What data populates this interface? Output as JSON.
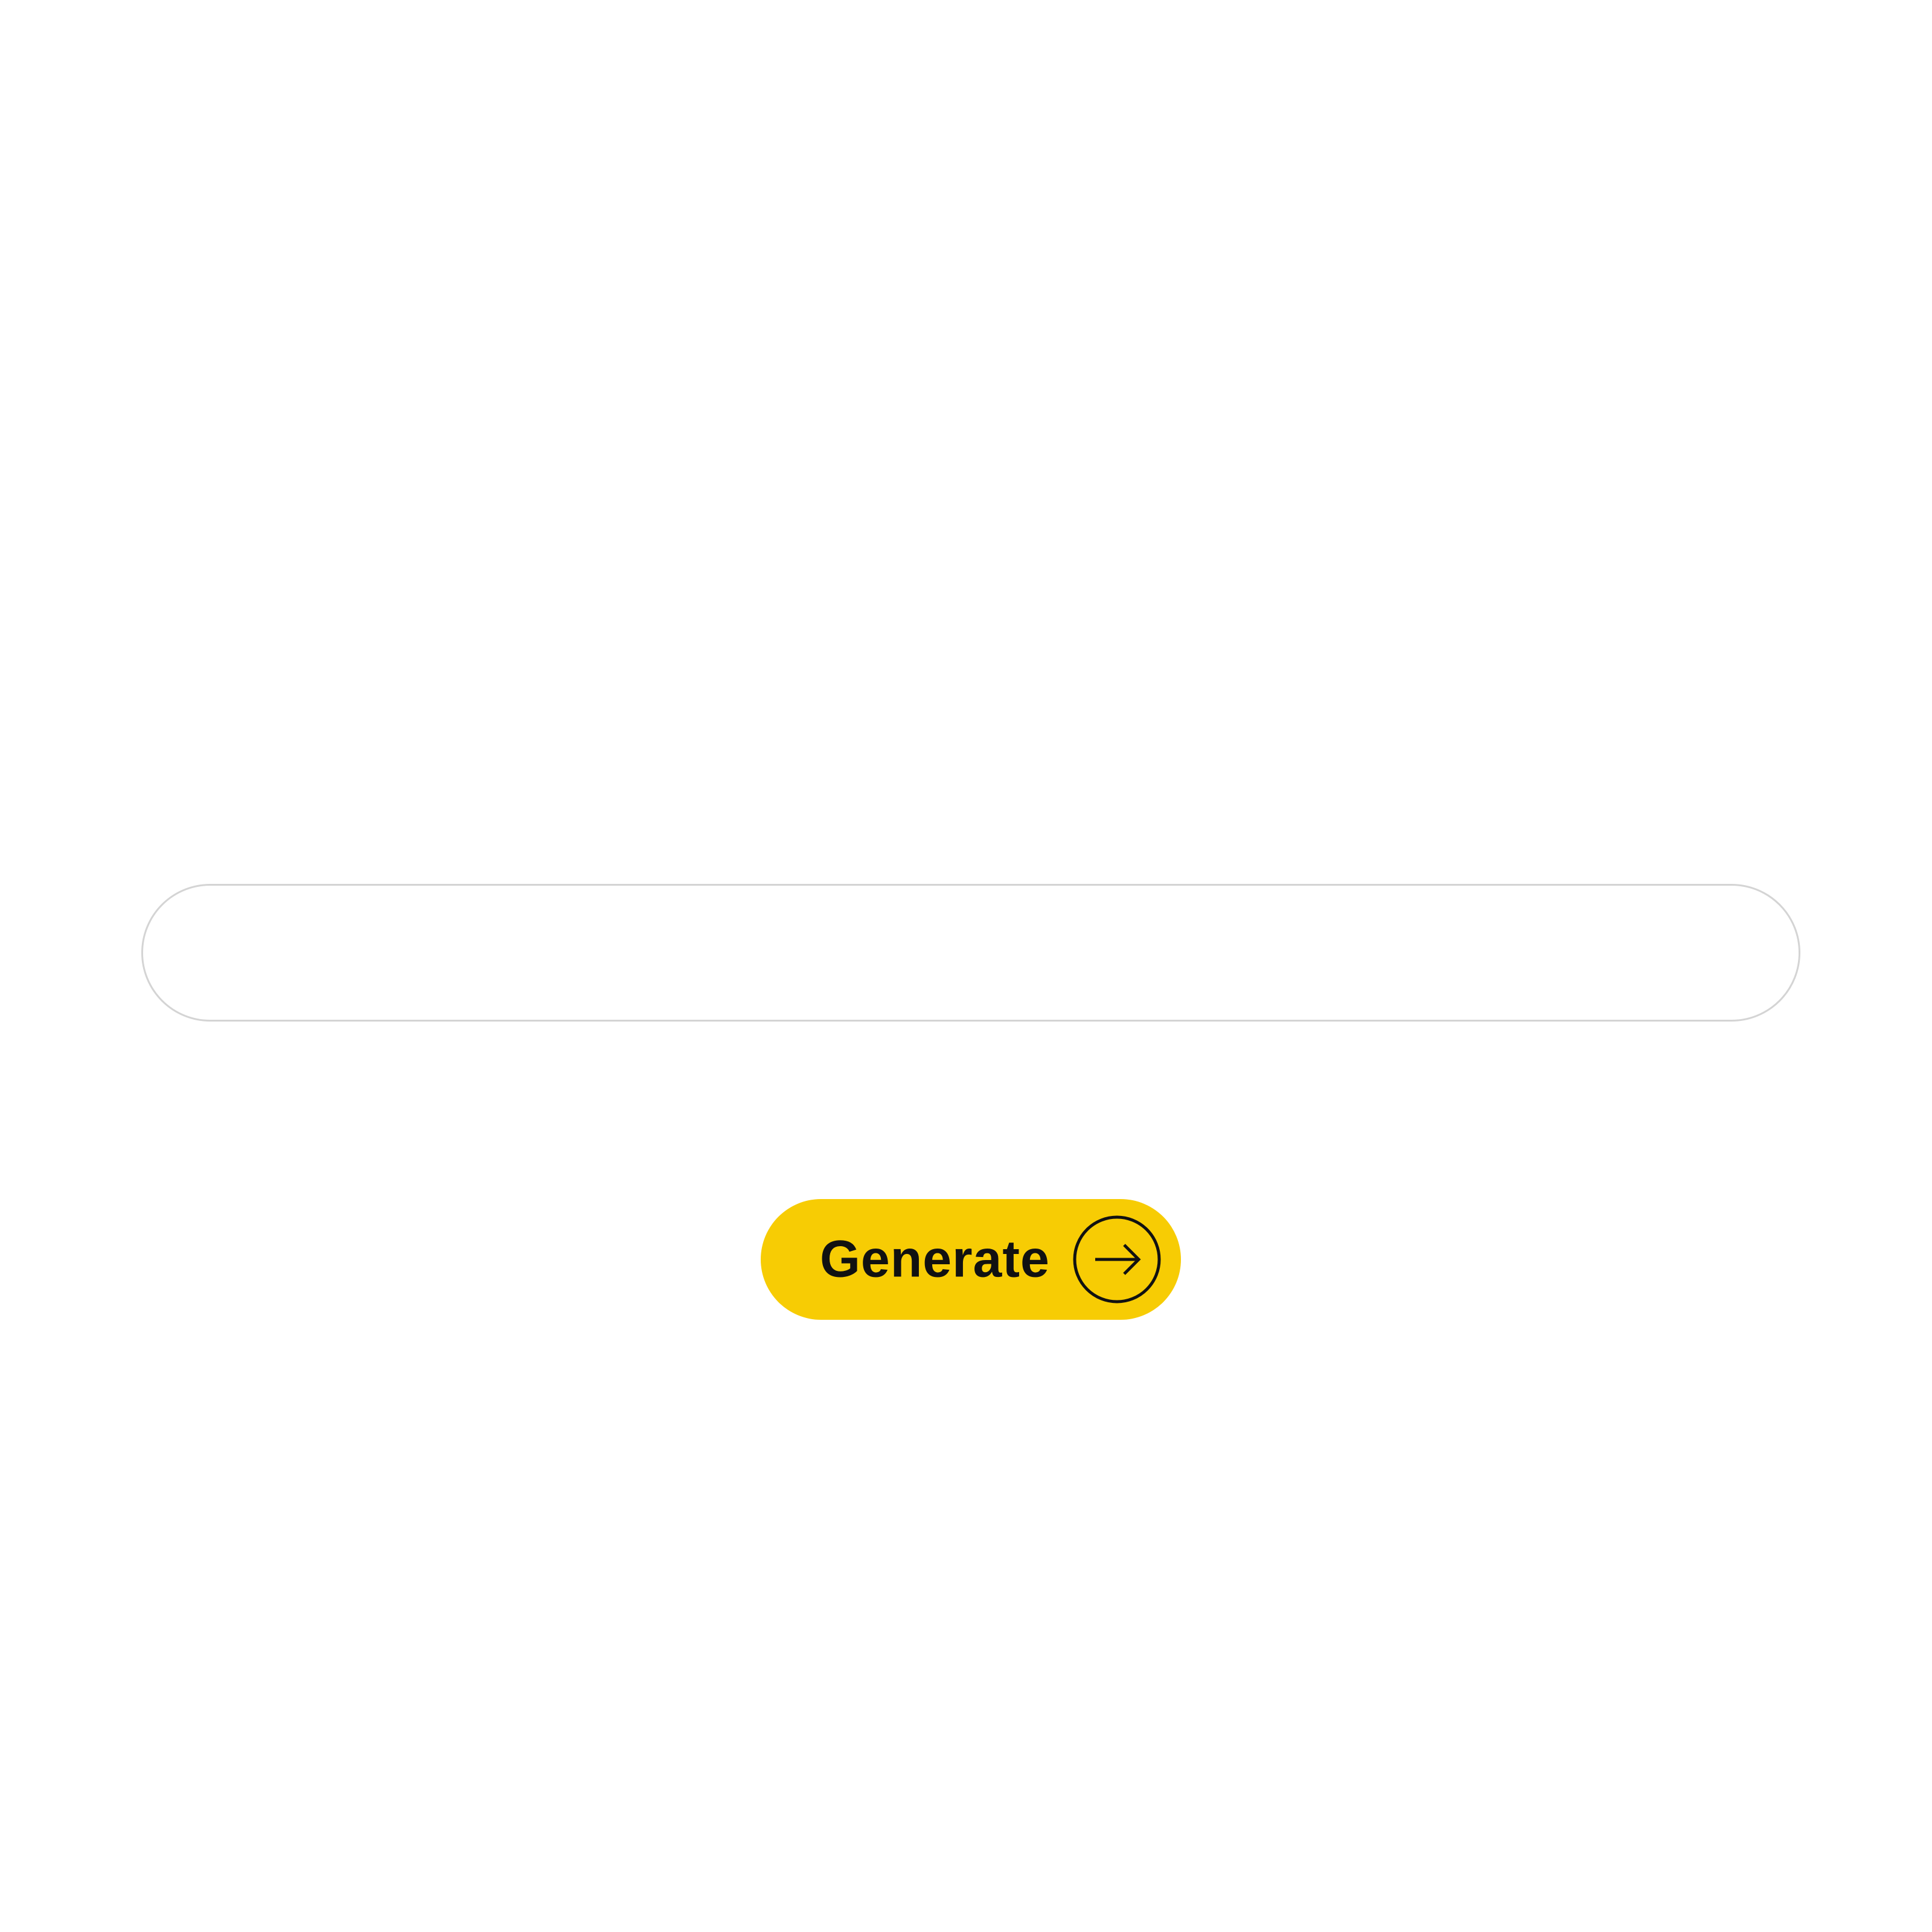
{
  "prompt": {
    "value": "",
    "placeholder": ""
  },
  "generate_button": {
    "label": "Generate",
    "icon": "arrow-right-circle-icon",
    "background_color": "#f7cc04"
  }
}
